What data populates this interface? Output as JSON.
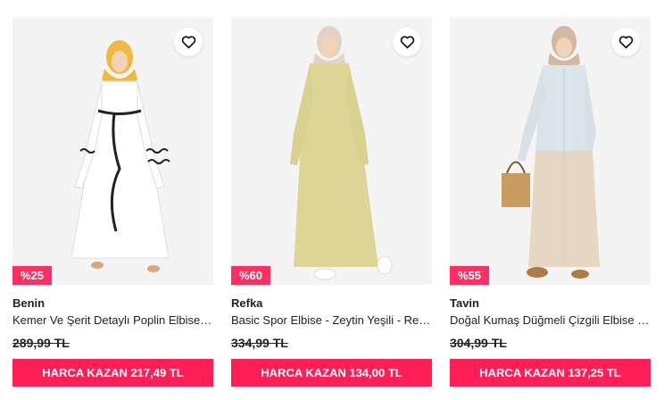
{
  "products": [
    {
      "brand": "Benin",
      "name": "Kemer Ve Şerit Detaylı Poplin Elbise - Beyaz - Benin",
      "old_price": "289,99 TL",
      "discount": "%25",
      "cta": "HARCA KAZAN 217,49 TL"
    },
    {
      "brand": "Refka",
      "name": "Basic Spor Elbise - Zeytin Yeşili - Refka",
      "old_price": "334,99 TL",
      "discount": "%60",
      "cta": "HARCA KAZAN 134,00 TL"
    },
    {
      "brand": "Tavin",
      "name": "Doğal Kumaş Düğmeli Çizgili Elbise - Bej - Tavin",
      "old_price": "304,99 TL",
      "discount": "%55",
      "cta": "HARCA KAZAN 137,25 TL"
    }
  ],
  "icons": {
    "favorite": "heart-outline-icon"
  },
  "colors": {
    "badge": "#ff2e63",
    "cta": "#ff1f56",
    "text": "#222222"
  }
}
